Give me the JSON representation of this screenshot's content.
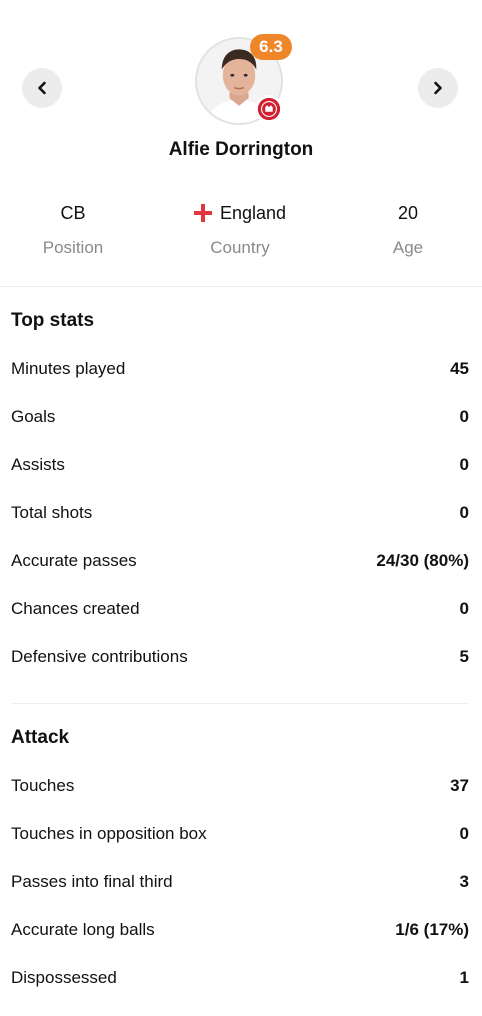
{
  "player": {
    "name": "Alfie Dorrington",
    "rating": "6.3",
    "rating_color": "#f0862a"
  },
  "info": {
    "position": {
      "value": "CB",
      "label": "Position"
    },
    "country": {
      "value": "England",
      "label": "Country",
      "flag_icon": "england-flag-icon"
    },
    "age": {
      "value": "20",
      "label": "Age"
    }
  },
  "top_stats": {
    "title": "Top stats",
    "rows": [
      {
        "label": "Minutes played",
        "value": "45"
      },
      {
        "label": "Goals",
        "value": "0"
      },
      {
        "label": "Assists",
        "value": "0"
      },
      {
        "label": "Total shots",
        "value": "0"
      },
      {
        "label": "Accurate passes",
        "value": "24/30 (80%)"
      },
      {
        "label": "Chances created",
        "value": "0"
      },
      {
        "label": "Defensive contributions",
        "value": "5"
      }
    ]
  },
  "attack": {
    "title": "Attack",
    "rows": [
      {
        "label": "Touches",
        "value": "37"
      },
      {
        "label": "Touches in opposition box",
        "value": "0"
      },
      {
        "label": "Passes into final third",
        "value": "3"
      },
      {
        "label": "Accurate long balls",
        "value": "1/6 (17%)"
      },
      {
        "label": "Dispossessed",
        "value": "1"
      }
    ]
  }
}
